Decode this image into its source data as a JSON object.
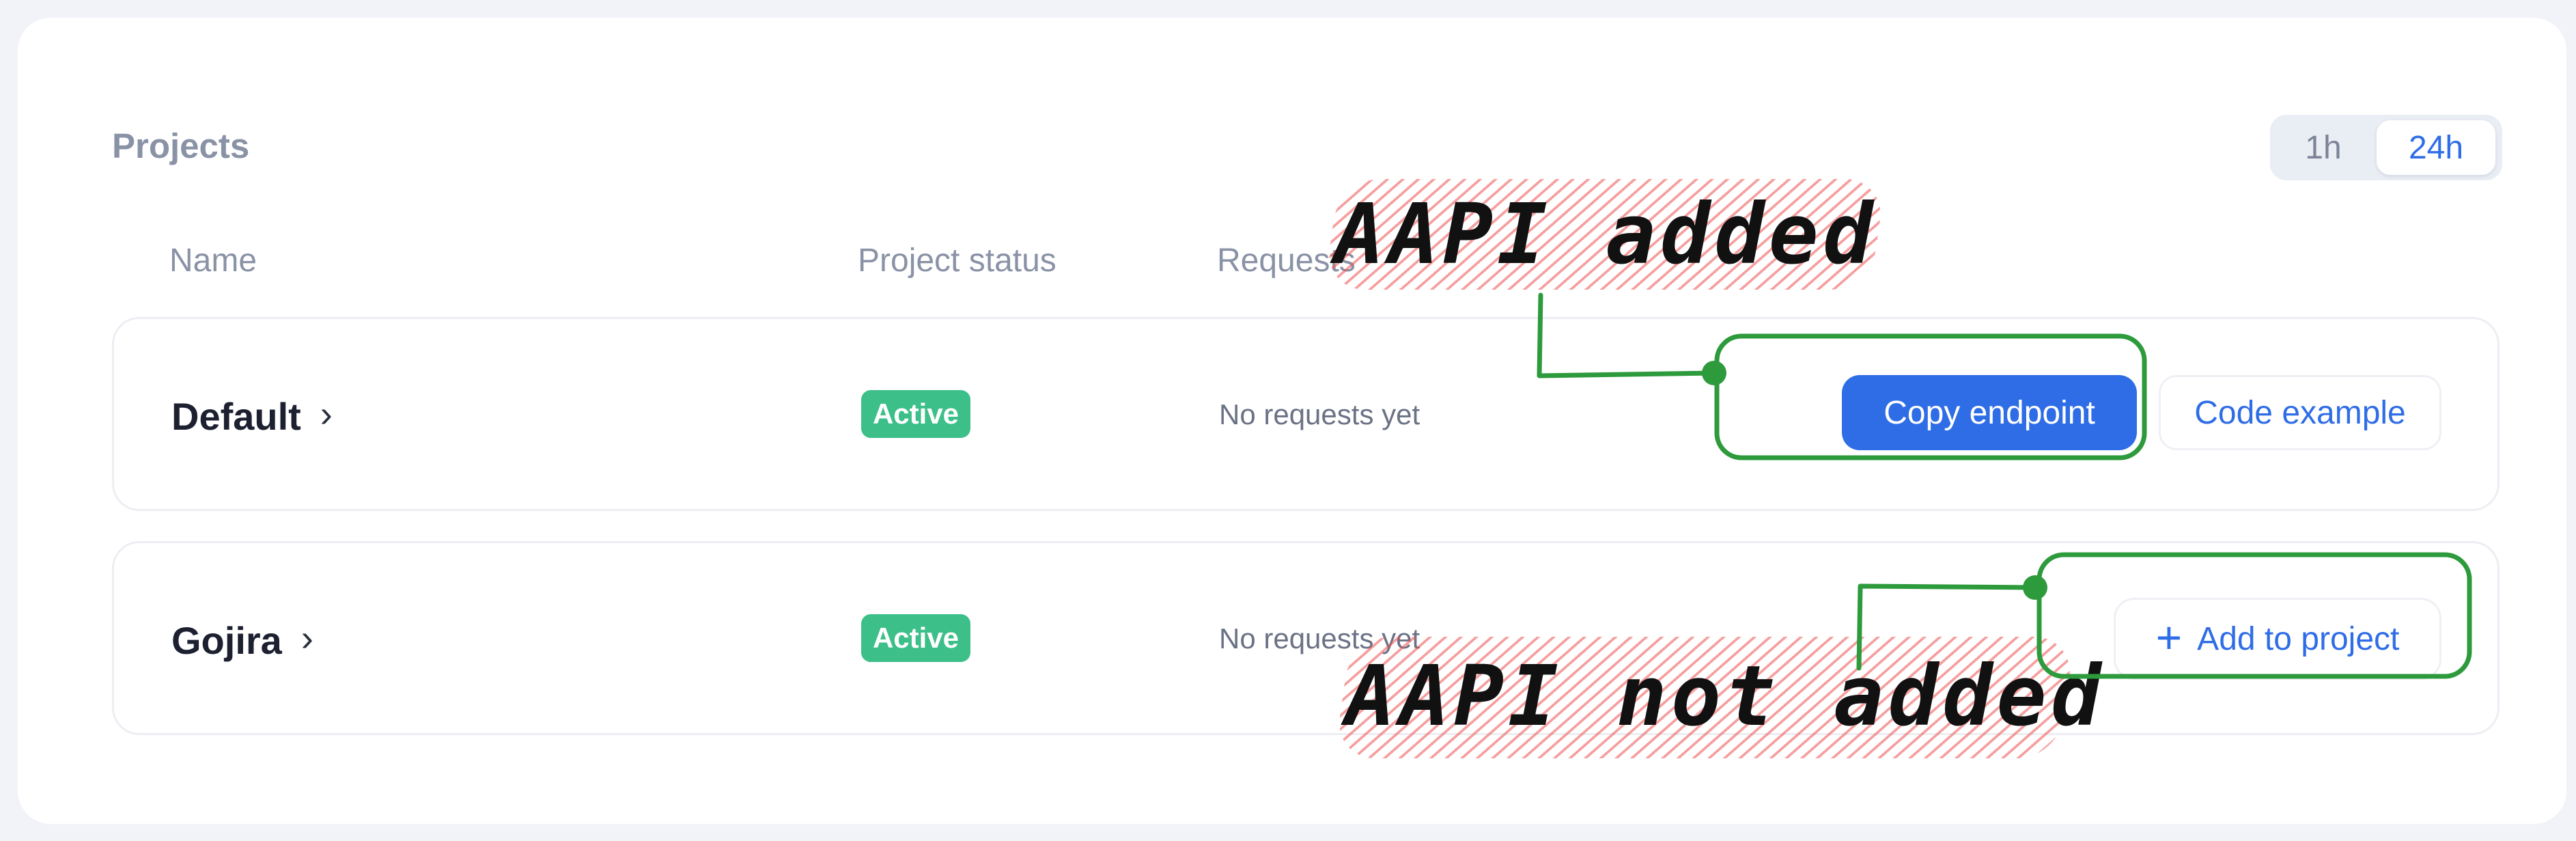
{
  "panel": {
    "title": "Projects",
    "range_toggle": {
      "options": [
        "1h",
        "24h"
      ],
      "selected": "24h"
    }
  },
  "table": {
    "columns": [
      "Name",
      "Project status",
      "Requests"
    ],
    "rows": [
      {
        "name": "Default",
        "status": "Active",
        "requests": "No requests yet",
        "actions": [
          "Copy endpoint",
          "Code example"
        ]
      },
      {
        "name": "Gojira",
        "status": "Active",
        "requests": "No requests yet",
        "actions": [
          "Add to project"
        ]
      }
    ]
  },
  "annotations": {
    "top": "AAPI added",
    "bottom": "AAPI not added"
  },
  "colors": {
    "accent": "#2f6de6",
    "status_active": "#3cbf88",
    "annotation_green": "#2d9a3c",
    "annotation_hatch": "#ef5050"
  },
  "icons": [
    "chevron-right-icon",
    "plus-icon"
  ]
}
